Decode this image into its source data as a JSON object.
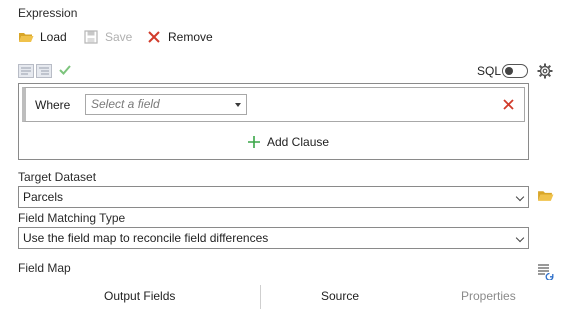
{
  "expression": {
    "title": "Expression",
    "toolbar": {
      "load_label": "Load",
      "save_label": "Save",
      "remove_label": "Remove"
    },
    "sql_label": "SQL",
    "clause": {
      "where_label": "Where",
      "field_placeholder": "Select a field"
    },
    "add_clause_label": "Add Clause"
  },
  "target_dataset": {
    "label": "Target Dataset",
    "value": "Parcels"
  },
  "field_matching": {
    "label": "Field Matching Type",
    "value": "Use the field map to reconcile field differences"
  },
  "field_map": {
    "label": "Field Map",
    "columns": [
      "Output Fields",
      "Source",
      "Properties"
    ]
  },
  "colors": {
    "folder": "#e8b83c",
    "remove_red": "#d13b2b",
    "add_green": "#3aa648",
    "check_green": "#7cc47c",
    "disabled_gray": "#b0b0b0"
  }
}
